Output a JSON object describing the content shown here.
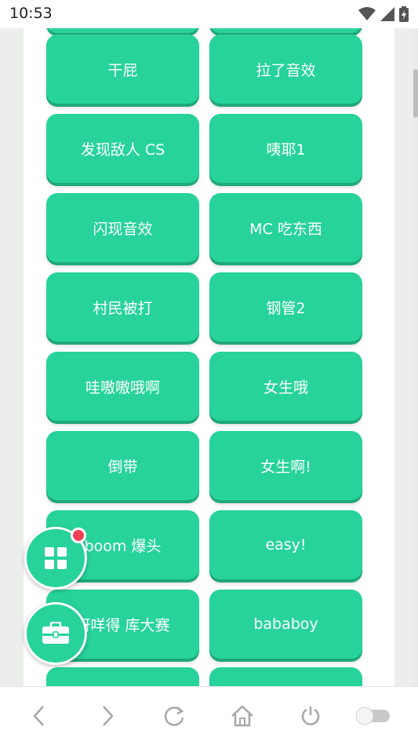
{
  "status_bar": {
    "time": "10:53",
    "icons": [
      "wifi-icon",
      "signal-icon",
      "battery-icon"
    ]
  },
  "sound_buttons": [
    {
      "label": "干屁"
    },
    {
      "label": "拉了音效"
    },
    {
      "label": "发现敌人 CS"
    },
    {
      "label": "咦耶1"
    },
    {
      "label": "闪现音效"
    },
    {
      "label": "MC 吃东西"
    },
    {
      "label": "村民被打"
    },
    {
      "label": "钢管2"
    },
    {
      "label": "哇嗷嗷哦啊"
    },
    {
      "label": "女生哦"
    },
    {
      "label": "倒带"
    },
    {
      "label": "女生啊!"
    },
    {
      "label": "boom 爆头"
    },
    {
      "label": "easy!"
    },
    {
      "label": "呀咩得 库大赛"
    },
    {
      "label": "bababoy"
    }
  ],
  "floating_buttons": {
    "apps_icon": "apps-grid-icon",
    "toolbox_icon": "toolbox-icon",
    "badge_color": "#ef4155"
  },
  "bottom_nav": {
    "items": [
      "back-icon",
      "forward-icon",
      "refresh-icon",
      "home-icon",
      "power-icon",
      "toggle-switch"
    ]
  },
  "colors": {
    "accent": "#27d39a",
    "accent_shadow": "#1fa878"
  }
}
